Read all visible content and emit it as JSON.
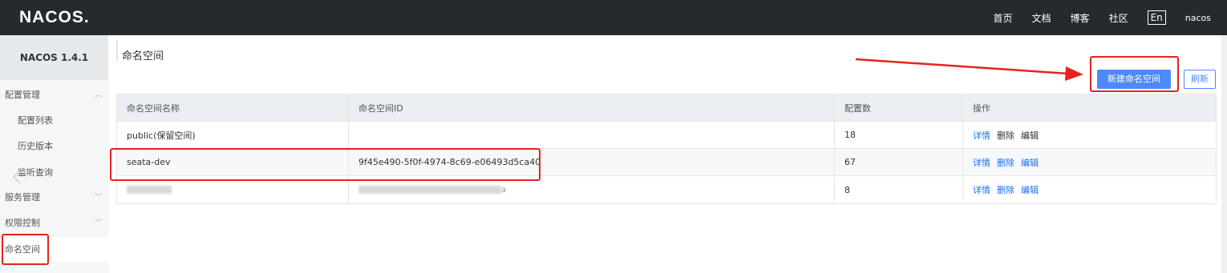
{
  "header": {
    "logo": "NACOS.",
    "nav": [
      "首页",
      "文档",
      "博客",
      "社区"
    ],
    "lang": "En",
    "user": "nacos"
  },
  "sidebar": {
    "version": "NACOS 1.4.1",
    "items": [
      {
        "label": "配置管理",
        "type": "group"
      },
      {
        "label": "配置列表",
        "type": "child"
      },
      {
        "label": "历史版本",
        "type": "child"
      },
      {
        "label": "监听查询",
        "type": "child"
      },
      {
        "label": "服务管理",
        "type": "group"
      },
      {
        "label": "权限控制",
        "type": "group"
      },
      {
        "label": "命名空间",
        "type": "group"
      }
    ]
  },
  "main": {
    "title": "命名空间",
    "new_button": "新建命名空间",
    "refresh_button": "刷新",
    "columns": [
      "命名空间名称",
      "命名空间ID",
      "配置数",
      "操作"
    ],
    "rows": [
      {
        "name": "public(保留空间)",
        "id": "",
        "count": "18",
        "actions": [
          "详情",
          "删除",
          "编辑"
        ]
      },
      {
        "name": "seata-dev",
        "id": "9f45e490-5f0f-4974-8c69-e06493d5ca40",
        "count": "67",
        "actions": [
          "详情",
          "删除",
          "编辑"
        ]
      },
      {
        "name": "",
        "id": "a",
        "count": "8",
        "actions": [
          "详情",
          "删除",
          "编辑"
        ]
      }
    ]
  },
  "colors": {
    "topbar": "#252a2f",
    "primary": "#4d89f7",
    "annotation": "#e5231e"
  }
}
